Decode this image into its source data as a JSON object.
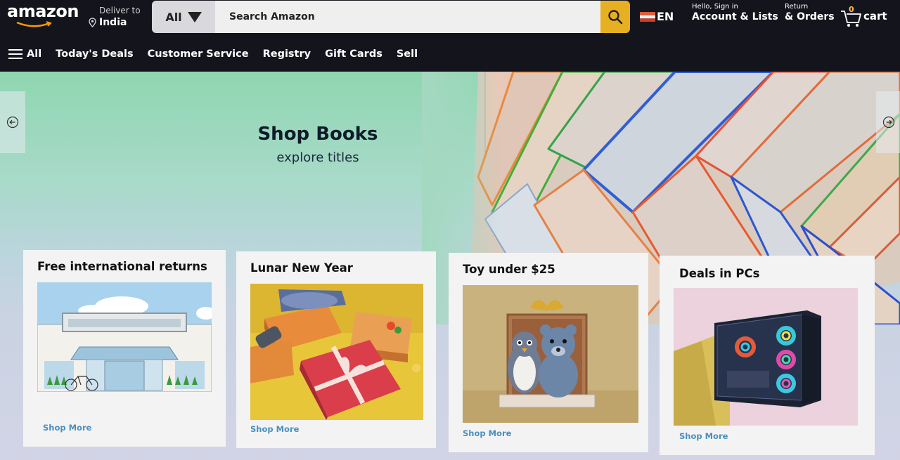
{
  "header": {
    "logo": "amazon",
    "deliver_line1": "Deliver to",
    "deliver_line2": "India",
    "search_category": "All",
    "search_placeholder": "Search Amazon",
    "language": "EN",
    "account_line1": "Hello, Sign in",
    "account_line2": "Account & Lists",
    "orders_line1": "Return",
    "orders_line2": "& Orders",
    "cart_count": "0",
    "cart_label": "cart"
  },
  "nav": {
    "menu_label": "All",
    "items": [
      "Today's Deals",
      "Customer Service",
      "Registry",
      "Gift Cards",
      "Sell"
    ]
  },
  "hero": {
    "title": "Shop Books",
    "subtitle": "explore titles"
  },
  "cards": [
    {
      "title": "Free international returns",
      "link": "Shop More"
    },
    {
      "title": "Lunar New Year",
      "link": "Shop More"
    },
    {
      "title": "Toy under $25",
      "link": "Shop More"
    },
    {
      "title": "Deals in PCs",
      "link": "Shop More"
    }
  ],
  "icons": {
    "search": "search-icon",
    "menu": "hamburger-menu-icon",
    "cart": "cart-icon",
    "location": "location-pin-icon",
    "flag": "flag-icon",
    "prev": "arrow-left-icon",
    "next": "arrow-right-icon"
  },
  "colors": {
    "header_bg": "#14151c",
    "search_button": "#e6b022",
    "link": "#4a8fbf",
    "hero_top": "#8fd6b0"
  }
}
